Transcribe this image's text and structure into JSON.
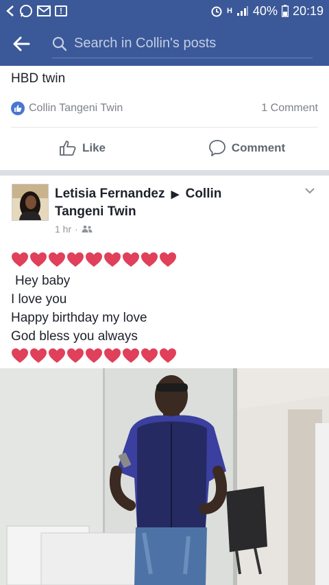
{
  "status_bar": {
    "battery": "40%",
    "time": "20:19",
    "network_type": "H",
    "left_icons": [
      "back-arrow-icon",
      "whatsapp-icon",
      "mail-icon",
      "alert-icon"
    ],
    "right_icons": [
      "alarm-icon",
      "network-type-icon",
      "signal-icon",
      "battery-icon"
    ]
  },
  "app_bar": {
    "search_placeholder": "Search in Collin's posts",
    "background_color": "#3b5998"
  },
  "post1": {
    "text": "HBD twin",
    "reaction_name": "Collin Tangeni Twin",
    "comment_count": "1 Comment",
    "like_label": "Like",
    "comment_label": "Comment"
  },
  "post2": {
    "author": "Letisia Fernandez",
    "target_line1": "Collin",
    "target_line2": "Tangeni Twin",
    "time": "1 hr",
    "audience_icon": "friends-icon",
    "lines": [
      "Hey baby",
      "I love you",
      "Happy birthday my love",
      "God bless you always"
    ],
    "hearts_count": 9,
    "heart_color": "#e0405a"
  }
}
